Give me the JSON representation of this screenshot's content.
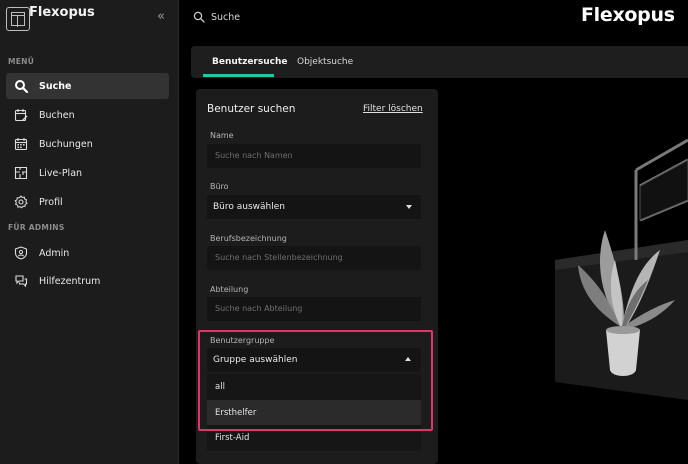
{
  "app": {
    "name": "Flexopus",
    "collapse_glyph": "«"
  },
  "sidebar": {
    "section_menu": "MENÜ",
    "section_admin": "FÜR ADMINS",
    "items": [
      {
        "label": "Suche",
        "icon": "search-icon",
        "active": true
      },
      {
        "label": "Buchen",
        "icon": "calendar-edit-icon"
      },
      {
        "label": "Buchungen",
        "icon": "calendar-icon"
      },
      {
        "label": "Live-Plan",
        "icon": "floorplan-icon"
      },
      {
        "label": "Profil",
        "icon": "gear-icon"
      }
    ],
    "admin_items": [
      {
        "label": "Admin",
        "icon": "shield-user-icon"
      },
      {
        "label": "Hilfezentrum",
        "icon": "help-chat-icon"
      }
    ]
  },
  "topbar": {
    "search_label": "Suche",
    "brand": "Flexopus"
  },
  "tabs": [
    {
      "label": "Benutzersuche",
      "active": true
    },
    {
      "label": "Objektsuche"
    }
  ],
  "filter": {
    "title": "Benutzer suchen",
    "clear_link": "Filter löschen",
    "name": {
      "label": "Name",
      "placeholder": "Suche nach Namen"
    },
    "office": {
      "label": "Büro",
      "value": "Büro auswählen"
    },
    "job_title": {
      "label": "Berufsbezeichnung",
      "placeholder": "Suche nach Stellenbezeichnung"
    },
    "department": {
      "label": "Abteilung",
      "placeholder": "Suche nach Abteilung"
    },
    "user_group": {
      "label": "Benutzergruppe",
      "value": "Gruppe auswählen",
      "options": [
        "all",
        "Ersthelfer",
        "First-Aid"
      ]
    }
  },
  "colors": {
    "accent": "#25c6a6",
    "highlight": "#e0356b"
  }
}
